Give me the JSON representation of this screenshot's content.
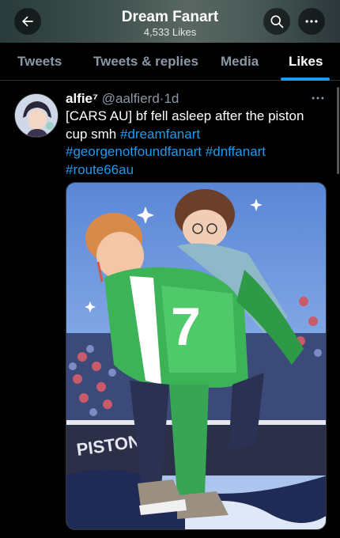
{
  "header": {
    "title": "Dream Fanart",
    "subtitle": "4,533 Likes",
    "back_icon": "arrow-left-icon",
    "search_icon": "search-icon",
    "more_icon": "more-horizontal-icon"
  },
  "tabs": [
    {
      "label": "Tweets",
      "active": false
    },
    {
      "label": "Tweets & replies",
      "active": false
    },
    {
      "label": "Media",
      "active": false
    },
    {
      "label": "Likes",
      "active": true
    }
  ],
  "tweet": {
    "display_name": "alfie⁷",
    "handle": "@aalfierd",
    "separator": "·",
    "time": "1d",
    "text": "[CARS AU] bf fell asleep after the piston cup smh",
    "hashtags": [
      "#dreamfanart",
      "#georgenotfoundfanart",
      "#dnffanart",
      "#route66au"
    ],
    "more_icon": "more-horizontal-icon",
    "media_text": {
      "jersey_number": "7",
      "banner": "PISTON"
    }
  },
  "colors": {
    "accent": "#1d9bf0",
    "background": "#000000",
    "secondary_text": "#8b98a5",
    "divider": "#2f3336"
  }
}
